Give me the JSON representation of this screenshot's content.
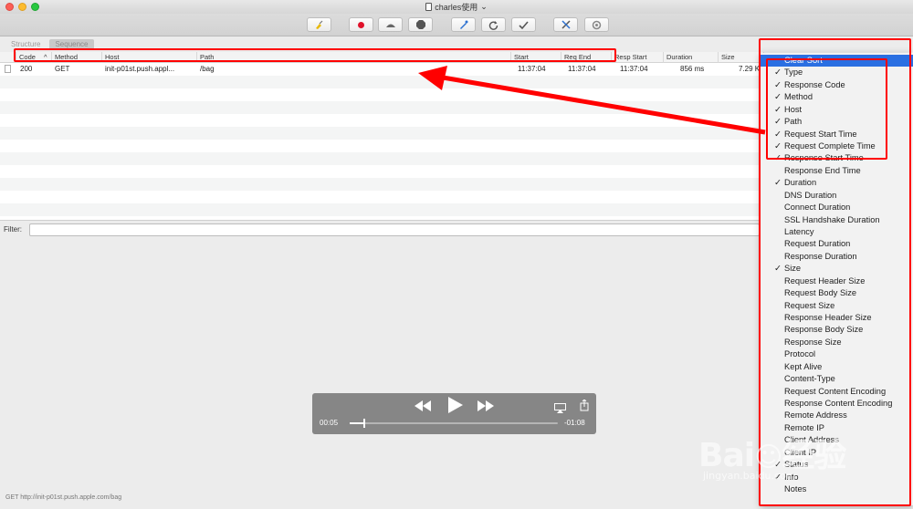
{
  "window": {
    "title": "charles使用",
    "title_caret": "⌄"
  },
  "tabs": [
    {
      "label": "Structure"
    },
    {
      "label": "Sequence"
    }
  ],
  "toolbar": {
    "icons": [
      "broom-icon",
      "record-icon",
      "throttle-icon",
      "breakpoint-icon",
      "compose-icon",
      "repeat-icon",
      "validate-icon",
      "tools-icon",
      "settings-icon"
    ]
  },
  "table": {
    "columns": [
      "Code",
      "Method",
      "Host",
      "Path",
      "Start",
      "Req End",
      "Resp Start",
      "Duration",
      "Size"
    ],
    "sort_indicator": "^",
    "rows": [
      {
        "code": "200",
        "method": "GET",
        "host": "init-p01st.push.appl...",
        "path": "/bag",
        "start": "11:37:04",
        "req_end": "11:37:04",
        "resp_start": "11:37:04",
        "duration": "856 ms",
        "size": "7.29 KB"
      }
    ]
  },
  "filter": {
    "label": "Filter:",
    "value": ""
  },
  "status": {
    "text": "GET http://init-p01st.push.apple.com/bag"
  },
  "video": {
    "elapsed": "00:05",
    "remaining": "-01:08",
    "progress": 0.07
  },
  "menu": {
    "items": [
      {
        "label": "Clear Sort",
        "checked": false,
        "highlighted": true
      },
      {
        "label": "Type",
        "checked": true
      },
      {
        "label": "Response Code",
        "checked": true
      },
      {
        "label": "Method",
        "checked": true
      },
      {
        "label": "Host",
        "checked": true
      },
      {
        "label": "Path",
        "checked": true
      },
      {
        "label": "Request Start Time",
        "checked": true
      },
      {
        "label": "Request Complete Time",
        "checked": true
      },
      {
        "label": "Response Start Time",
        "checked": true
      },
      {
        "label": "Response End Time",
        "checked": false
      },
      {
        "label": "Duration",
        "checked": true
      },
      {
        "label": "DNS Duration",
        "checked": false
      },
      {
        "label": "Connect Duration",
        "checked": false
      },
      {
        "label": "SSL Handshake Duration",
        "checked": false
      },
      {
        "label": "Latency",
        "checked": false
      },
      {
        "label": "Request Duration",
        "checked": false
      },
      {
        "label": "Response Duration",
        "checked": false
      },
      {
        "label": "Size",
        "checked": true
      },
      {
        "label": "Request Header Size",
        "checked": false
      },
      {
        "label": "Request Body Size",
        "checked": false
      },
      {
        "label": "Request Size",
        "checked": false
      },
      {
        "label": "Response Header Size",
        "checked": false
      },
      {
        "label": "Response Body Size",
        "checked": false
      },
      {
        "label": "Response Size",
        "checked": false
      },
      {
        "label": "Protocol",
        "checked": false
      },
      {
        "label": "Kept Alive",
        "checked": false
      },
      {
        "label": "Content-Type",
        "checked": false
      },
      {
        "label": "Request Content Encoding",
        "checked": false
      },
      {
        "label": "Response Content Encoding",
        "checked": false
      },
      {
        "label": "Remote Address",
        "checked": false
      },
      {
        "label": "Remote IP",
        "checked": false
      },
      {
        "label": "Client Address",
        "checked": false
      },
      {
        "label": "Client IP",
        "checked": false
      },
      {
        "label": "Status",
        "checked": true
      },
      {
        "label": "Info",
        "checked": true
      },
      {
        "label": "Notes",
        "checked": false
      }
    ]
  },
  "watermark": {
    "logo": "Baidu经验",
    "url": "jingyan.baidu.com"
  },
  "colors": {
    "annotation": "#ff0000",
    "menu_highlight": "#2a6fe2"
  }
}
